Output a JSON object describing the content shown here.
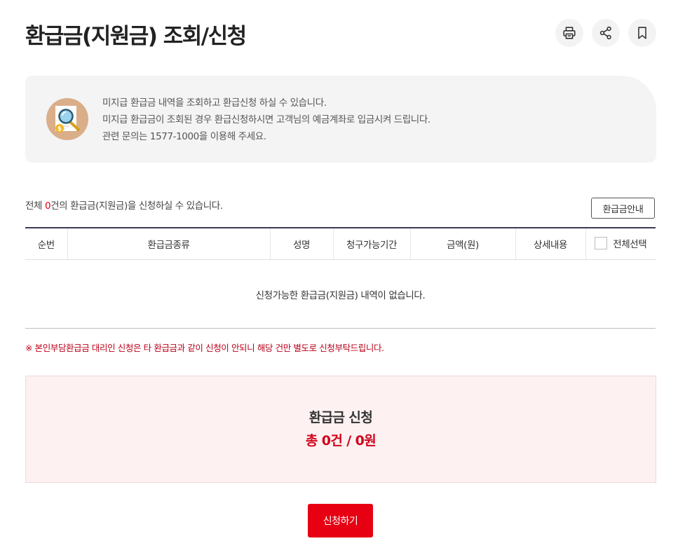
{
  "header": {
    "title": "환급금(지원금) 조회/신청",
    "actions": [
      {
        "name": "print",
        "icon": "printer-icon"
      },
      {
        "name": "share",
        "icon": "share-icon"
      },
      {
        "name": "bookmark",
        "icon": "bookmark-icon"
      }
    ]
  },
  "info": {
    "icon": "magnifier-document-icon",
    "lines": [
      "미지급 환급금 내역을 조회하고 환급신청 하실 수 있습니다.",
      "미지급 환급금이 조회된 경우 환급신청하시면 고객님의 예금계좌로 입금시켜 드립니다.",
      "관련 문의는 1577-1000을 이용해 주세요."
    ]
  },
  "summary": {
    "prefix": "전체 ",
    "count": "0",
    "suffix": "건의 환급금(지원금)을 신청하실 수 있습니다."
  },
  "guide_button": "환급금안내",
  "table": {
    "columns": [
      "순번",
      "환급금종류",
      "성명",
      "청구가능기간",
      "금액(원)",
      "상세내용",
      "전체선택"
    ],
    "empty_message": "신청가능한 환급금(지원금) 내역이 없습니다.",
    "rows": []
  },
  "notice": "※ 본인부담환급금 대리인 신청은 타 환급금과 같이 신청이 안되니 해당 건만 별도로 신청부탁드립니다.",
  "apply_summary": {
    "title": "환급금 신청",
    "total": "총 0건 / 0원"
  },
  "apply_button": "신청하기",
  "colors": {
    "accent": "#e60012",
    "notice": "#b8001a",
    "total": "#d0021b",
    "info_bg": "#f4f4f5",
    "summary_bg": "#fdf1f1",
    "table_top_border": "#3a3a55"
  }
}
